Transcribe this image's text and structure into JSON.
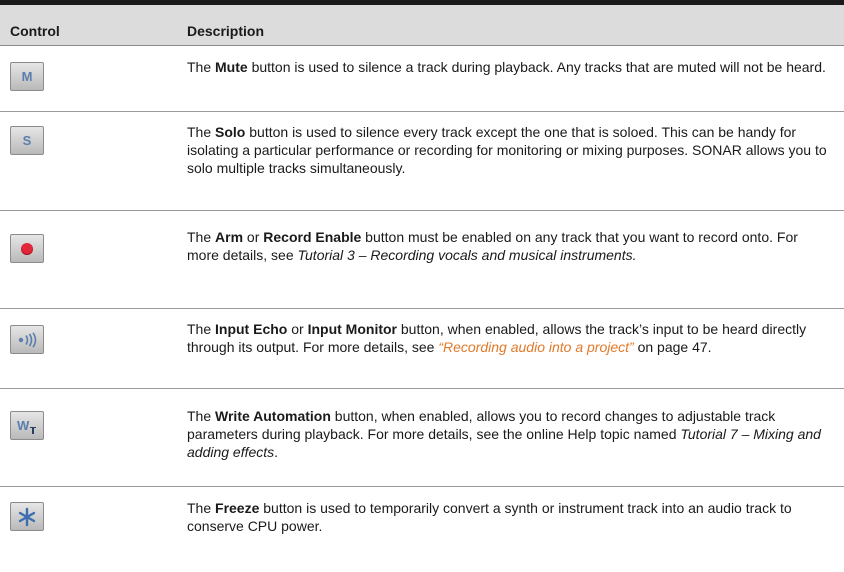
{
  "table": {
    "headers": {
      "control": "Control",
      "description": "Description"
    },
    "rows": [
      {
        "button_glyph": "M",
        "parts": [
          "The ",
          "Mute",
          " button is used to silence a track during playback. Any tracks that are muted will not be heard."
        ]
      },
      {
        "button_glyph": "S",
        "parts": [
          "The ",
          "Solo",
          " button is used to silence every track except the one that is soloed. This can be handy for isolating a particular performance or recording for monitoring or mixing purposes. SONAR allows you to solo multiple tracks simultaneously."
        ]
      },
      {
        "button_icon": "record-dot-icon",
        "parts": [
          "The ",
          "Arm",
          " or ",
          "Record Enable",
          " button must be enabled on any track that you want to record onto. For more details, see ",
          "Tutorial 3 – Recording vocals and musical instruments."
        ]
      },
      {
        "button_icon": "input-echo-icon",
        "parts": [
          "The ",
          "Input Echo",
          " or ",
          "Input Monitor",
          " button, when enabled, allows the track’s input to be heard directly through its output. For more details, see ",
          "“Recording audio into a project”",
          " on page 47."
        ]
      },
      {
        "button_glyph": "W",
        "parts": [
          "The ",
          "Write Automation",
          " button, when enabled, allows you to record changes to adjustable track parameters during playback. For more details, see the online Help topic named ",
          "Tutorial 7 – Mixing and adding effects",
          "."
        ]
      },
      {
        "button_icon": "freeze-asterisk-icon",
        "parts": [
          "The ",
          "Freeze",
          " button is used to temporarily convert a synth or instrument track into an audio track to conserve CPU power."
        ]
      }
    ]
  },
  "colors": {
    "link": "#e07a2a",
    "record": "#e0283a",
    "button_glyph": "#5a7fae",
    "header_bg": "#dcdcdc"
  }
}
